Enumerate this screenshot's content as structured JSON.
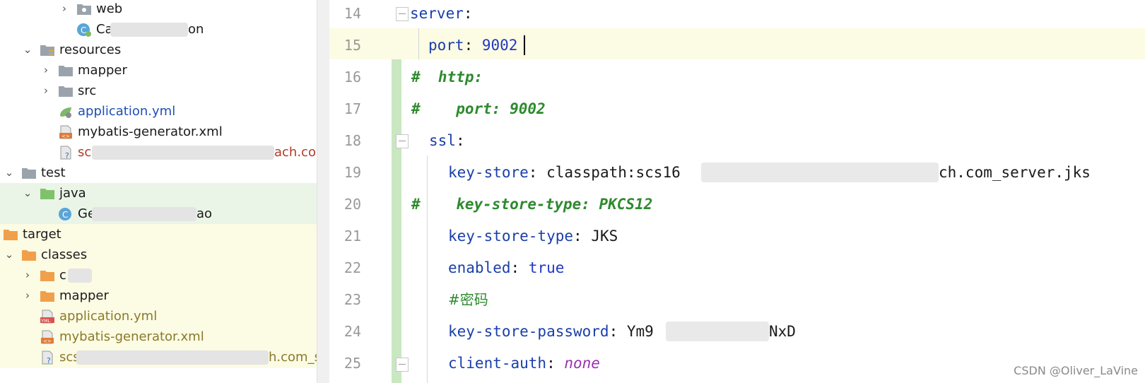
{
  "tree": {
    "items": [
      {
        "label": "web",
        "blur_suffix": ""
      },
      {
        "label": "Ca",
        "tail": "on"
      },
      {
        "label": "resources"
      },
      {
        "label": "mapper"
      },
      {
        "label": "src"
      },
      {
        "label": "application.yml"
      },
      {
        "label": "mybatis-generator.xml"
      },
      {
        "label": "sc",
        "tail": "ach.com_"
      },
      {
        "label": "test"
      },
      {
        "label": "java"
      },
      {
        "label": "Ge",
        "tail": "ao"
      },
      {
        "label": "target"
      },
      {
        "label": "classes"
      },
      {
        "label": "c"
      },
      {
        "label": "mapper"
      },
      {
        "label": "application.yml"
      },
      {
        "label": "mybatis-generator.xml"
      },
      {
        "label": "scs",
        "tail": "h.com_ser"
      }
    ]
  },
  "editor": {
    "lines": [
      {
        "n": "14",
        "key": "server",
        "sep": ":"
      },
      {
        "n": "15",
        "key": "port",
        "sep": ": ",
        "val": "9002"
      },
      {
        "n": "16",
        "comment": "#  http:"
      },
      {
        "n": "17",
        "comment": "#    port: 9002"
      },
      {
        "n": "18",
        "key": "ssl",
        "sep": ":"
      },
      {
        "n": "19",
        "key": "key-store",
        "sep": ": ",
        "val": "classpath:scs16",
        "tail": "ch.com_server.jks"
      },
      {
        "n": "20",
        "comment": "#    key-store-type: PKCS12"
      },
      {
        "n": "21",
        "key": "key-store-type",
        "sep": ": ",
        "val": "JKS"
      },
      {
        "n": "22",
        "key": "enabled",
        "sep": ": ",
        "val": "true"
      },
      {
        "n": "23",
        "comment": "#密码"
      },
      {
        "n": "24",
        "key": "key-store-password",
        "sep": ": ",
        "val": "Ym9",
        "tail": "NxD"
      },
      {
        "n": "25",
        "key": "client-auth",
        "sep": ": ",
        "val": "none"
      }
    ]
  },
  "watermark": "CSDN @Oliver_LaVine",
  "colors": {
    "key": "#1a3fa8",
    "comment": "#2e8a2e",
    "selected_row": "#eaf5e7",
    "target_row": "#fcfbe4",
    "change_bar": "#c9e7c1"
  }
}
